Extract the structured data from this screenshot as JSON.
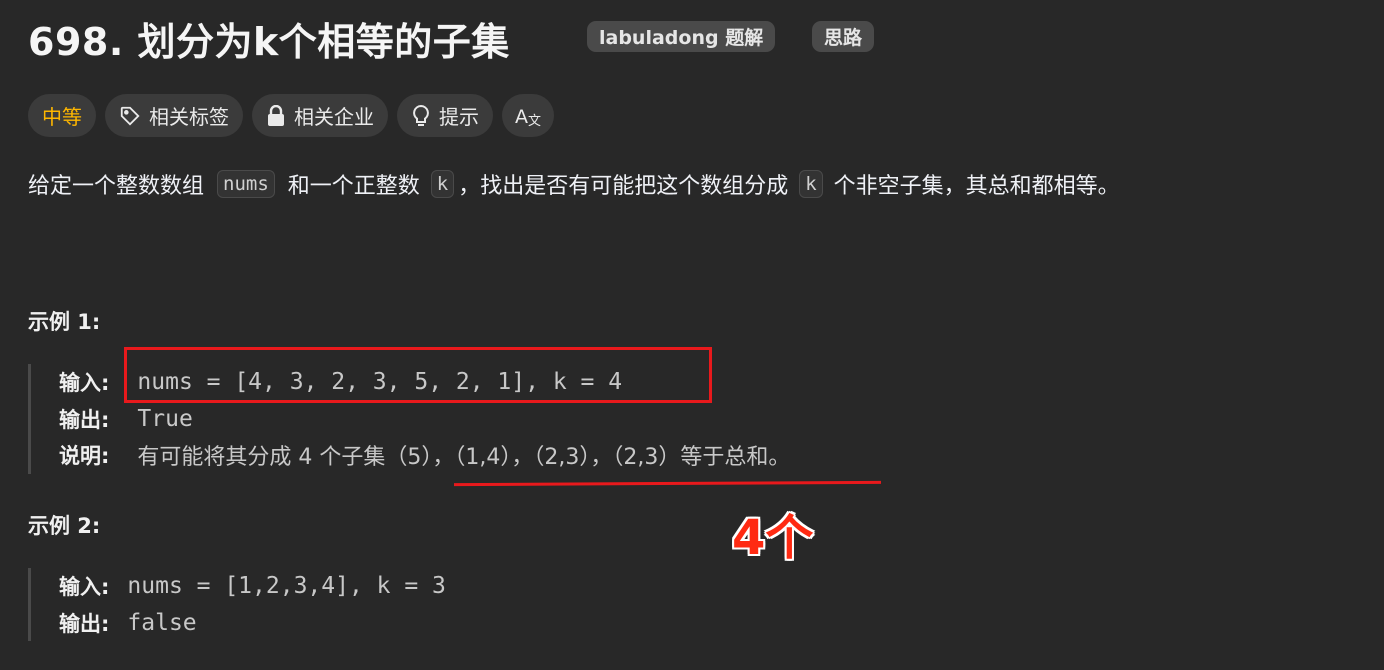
{
  "problem": {
    "title": "698. 划分为k个相等的子集",
    "solution_link": "labuladong 题解",
    "idea_link": "思路"
  },
  "tags": {
    "difficulty": "中等",
    "related_tags": "相关标签",
    "related_companies": "相关企业",
    "hint": "提示",
    "translate_icon": "translate-icon"
  },
  "description": {
    "part1": "给定一个整数数组 ",
    "code1": "nums",
    "part2": " 和一个正整数 ",
    "code2": "k",
    "part3": "，找出是否有可能把这个数组分成 ",
    "code3": "k",
    "part4": " 个非空子集，其总和都相等。"
  },
  "example1": {
    "title": "示例 1:",
    "input_label": "输入:",
    "input_value": "nums = [4, 3, 2, 3, 5, 2, 1], k = 4",
    "output_label": "输出:",
    "output_value": "True",
    "explain_label": "说明:",
    "explain_value": "有可能将其分成 4 个子集（5），（1,4），（2,3），（2,3）等于总和。"
  },
  "example2": {
    "title": "示例 2:",
    "input_label": "输入:",
    "input_value": "nums = [1,2,3,4], k = 3",
    "output_label": "输出:",
    "output_value": "false"
  },
  "annotation": {
    "text": "4个",
    "color": "#ff2a12"
  },
  "colors": {
    "background": "#282828",
    "difficulty": "#ffb700",
    "annotation_red": "#e8191c"
  }
}
